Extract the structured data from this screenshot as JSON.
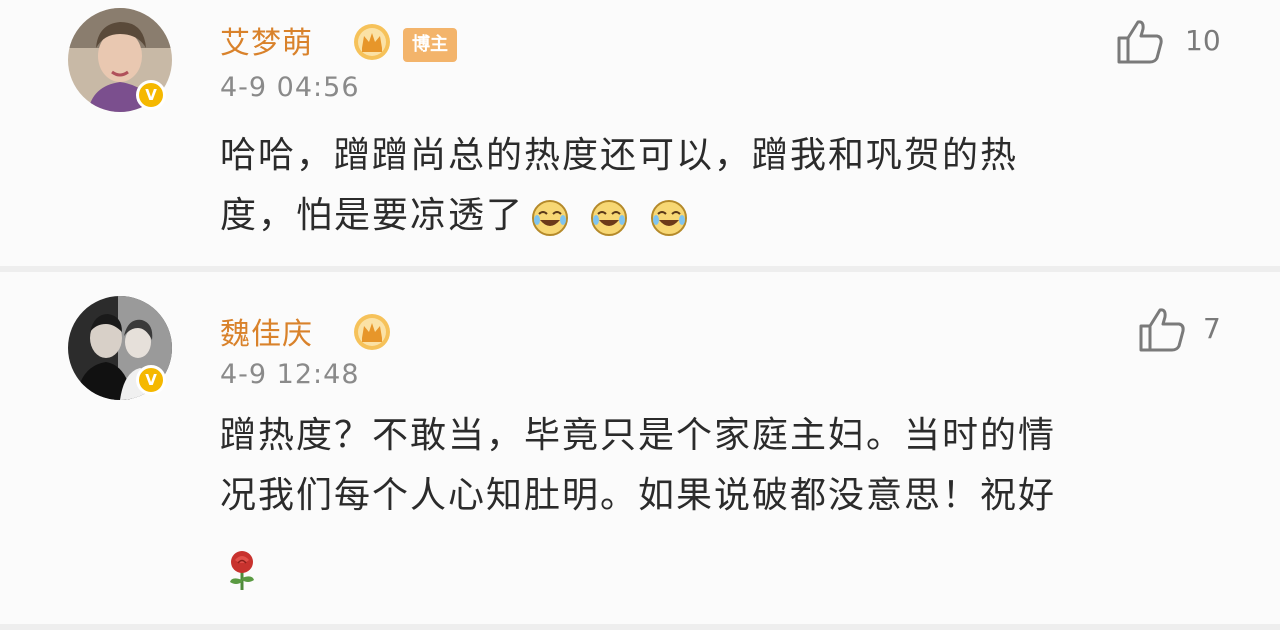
{
  "comments": [
    {
      "username": "艾梦萌",
      "badge_blogger": "博主",
      "timestamp": "4-9 04:56",
      "likes": "10",
      "text_line1": "哈哈，蹭蹭尚总的热度还可以，蹭我和巩贺的热",
      "text_line2": "度，怕是要凉透了",
      "emojis": [
        "laugh-cry-emoji",
        "laugh-cry-emoji",
        "laugh-cry-emoji"
      ],
      "verified_icon": "verified-v-icon",
      "crown_icon": "crown-icon"
    },
    {
      "username": "魏佳庆",
      "timestamp": "4-9 12:48",
      "likes": "7",
      "text_line1": "蹭热度？不敢当，毕竟只是个家庭主妇。当时的情",
      "text_line2": "况我们每个人心知肚明。如果说破都没意思！祝好",
      "trailing_icon": "rose-icon",
      "verified_icon": "verified-v-icon",
      "crown_icon": "crown-icon"
    }
  ],
  "colors": {
    "username": "#d9822b",
    "timestamp": "#8a8a8a",
    "body_text": "#2b2b2b",
    "verified_badge": "#f5b800",
    "blogger_badge": "#f3b46b"
  }
}
